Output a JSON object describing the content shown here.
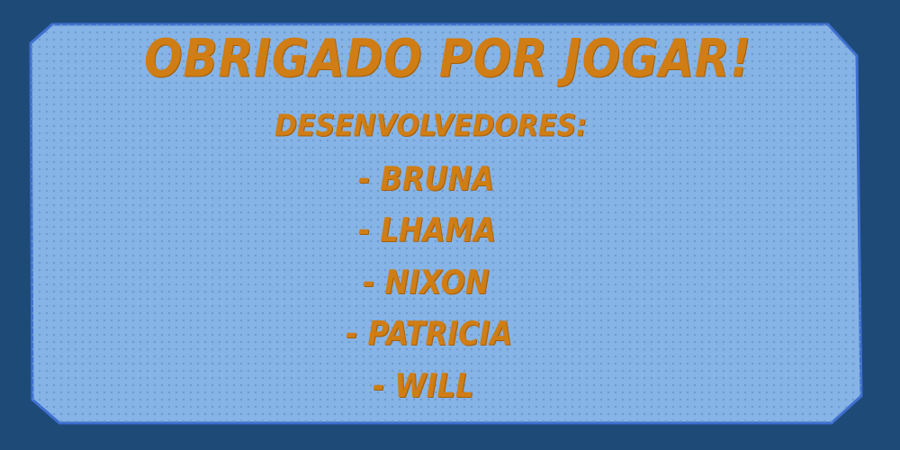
{
  "end_screen": {
    "title": "OBRIGADO POR JOGAR!",
    "subtitle": "DESENVOLVEDORES:",
    "developers": [
      "- BRUNA",
      "- LHAMA",
      "- NIXON",
      "- PATRICIA",
      "- WILL"
    ]
  },
  "colors": {
    "background": "#1e4a78",
    "panel_fill": "#86b4e6",
    "panel_border": "#3f6fd0",
    "halftone_dot": "#6c98cc",
    "text": "#cf7d14"
  }
}
